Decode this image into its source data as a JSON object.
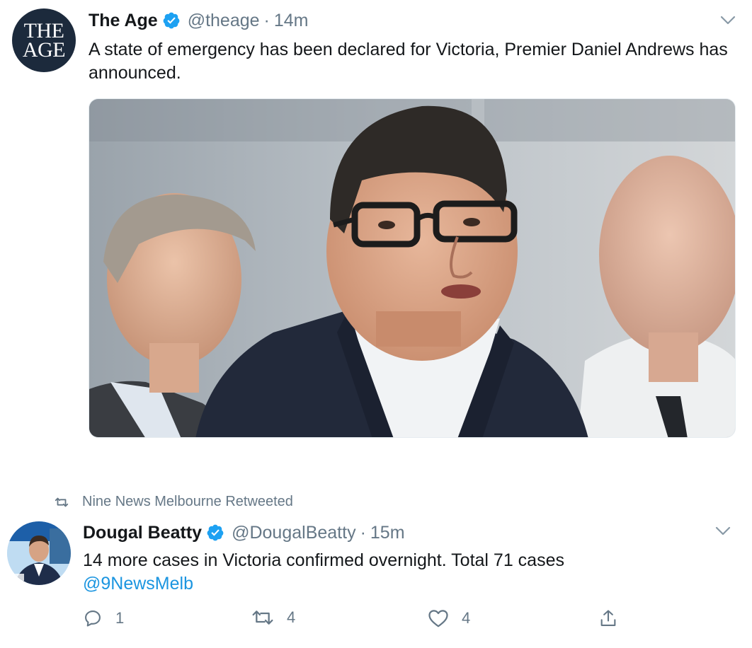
{
  "tweets": [
    {
      "avatar_text_line1": "THE",
      "avatar_text_line2": "AGE",
      "name": "The Age",
      "handle": "@theage",
      "separator": "·",
      "time": "14m",
      "text": "A state of emergency has been declared for Victoria, Premier Daniel Andrews has announced.",
      "verified_icon": "verified-badge-icon",
      "menu_icon": "chevron-down-icon"
    },
    {
      "retweet_context": "Nine News Melbourne Retweeted",
      "name": "Dougal Beatty",
      "handle": "@DougalBeatty",
      "separator": "·",
      "time": "15m",
      "text_line1": "14 more cases in Victoria confirmed overnight. Total 71 cases",
      "mention": "@9NewsMelb",
      "reply_count": "1",
      "retweet_count": "4",
      "like_count": "4",
      "verified_icon": "verified-badge-icon",
      "menu_icon": "chevron-down-icon"
    }
  ],
  "colors": {
    "text": "#14171a",
    "secondary": "#657786",
    "link": "#1b95e0",
    "verified": "#1da1f2"
  }
}
